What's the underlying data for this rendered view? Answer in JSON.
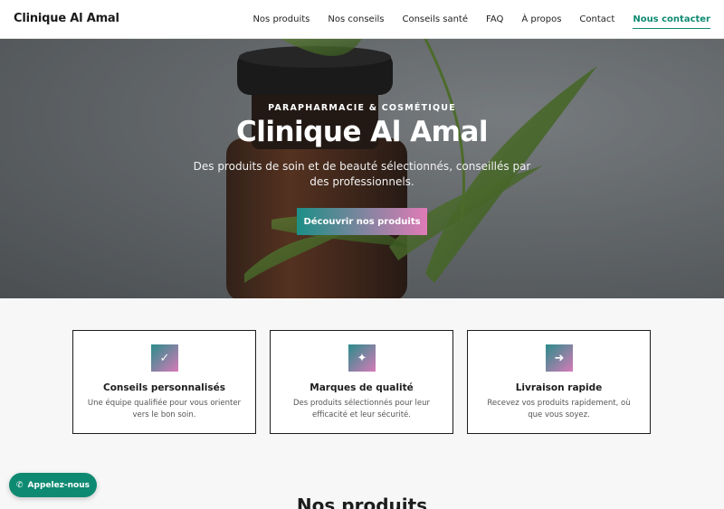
{
  "header": {
    "brand": "Clinique Al Amal",
    "nav": [
      {
        "label": "Nos produits"
      },
      {
        "label": "Nos conseils"
      },
      {
        "label": "Conseils santé"
      },
      {
        "label": "FAQ"
      },
      {
        "label": "À propos"
      },
      {
        "label": "Contact"
      },
      {
        "label": "Nous contacter"
      }
    ]
  },
  "hero": {
    "eyebrow": "PARAPHARMACIE & COSMÉTIQUE",
    "title": "Clinique Al Amal",
    "subtitle": "Des produits de soin et de beauté sélectionnés, conseillés par des professionnels.",
    "button_label": "Découvrir nos produits"
  },
  "features": [
    {
      "icon": "✓",
      "icon_name": "check-icon",
      "title": "Conseils personnalisés",
      "desc": "Une équipe qualifiée pour vous orienter vers le bon soin."
    },
    {
      "icon": "✦",
      "icon_name": "sparkle-icon",
      "title": "Marques de qualité",
      "desc": "Des produits sélectionnés pour leur efficacité et leur sécurité."
    },
    {
      "icon": "➜",
      "icon_name": "arrow-right-icon",
      "title": "Livraison rapide",
      "desc": "Recevez vos produits rapidement, où que vous soyez."
    }
  ],
  "products_section": {
    "title": "Nos produits"
  },
  "call_button": {
    "icon": "✆",
    "label": "Appelez-nous"
  },
  "colors": {
    "accent": "#0f8a72",
    "gradient_start": "#1c8f86",
    "gradient_end": "#e07bb7"
  }
}
